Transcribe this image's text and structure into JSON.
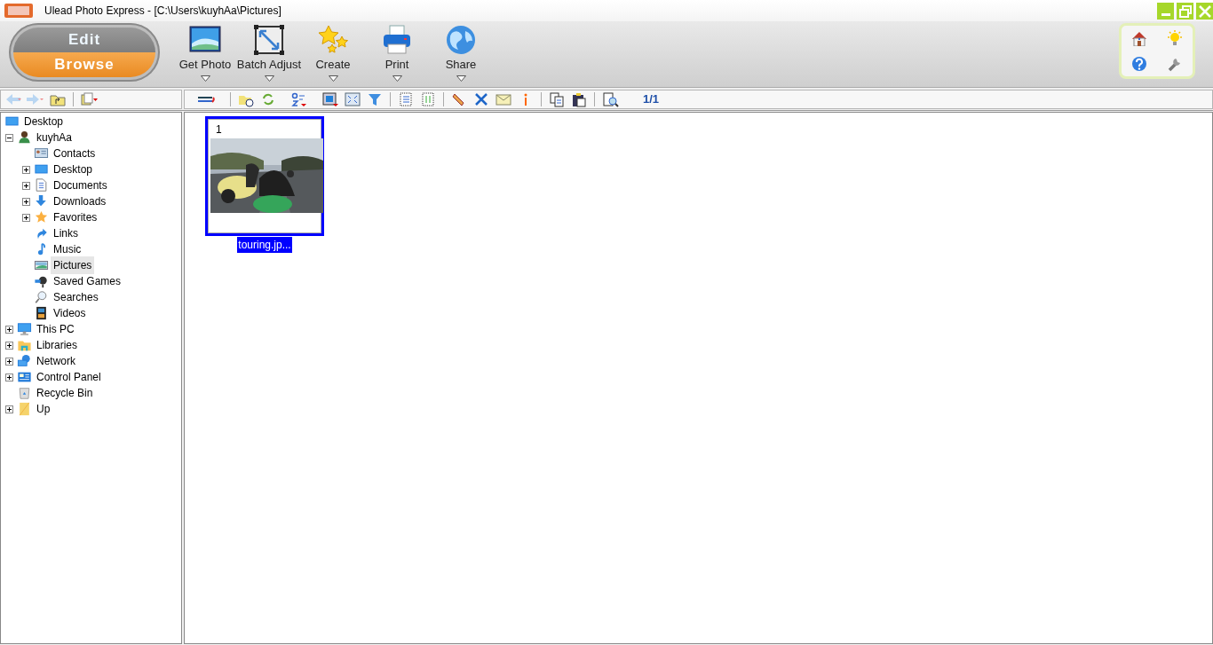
{
  "window": {
    "title": "Ulead Photo Express - [C:\\Users\\kuyhAa\\Pictures]"
  },
  "mode_switch": [
    {
      "label": "Edit",
      "selected": false
    },
    {
      "label": "Browse",
      "selected": true
    }
  ],
  "main_toolbar": [
    {
      "label": "Get Photo",
      "dropdown": true
    },
    {
      "label": "Batch Adjust",
      "dropdown": true
    },
    {
      "label": "Create",
      "dropdown": true
    },
    {
      "label": "Print",
      "dropdown": true
    },
    {
      "label": "Share",
      "dropdown": true
    }
  ],
  "browser_toolbar": {
    "page_counter": "1/1"
  },
  "folder_tree": [
    {
      "label": "Desktop",
      "selected": false,
      "children": [
        {
          "label": "kuyhAa",
          "expanded": true,
          "selected": false,
          "children": [
            {
              "label": "Contacts",
              "selected": false
            },
            {
              "label": "Desktop",
              "expanded": false,
              "selected": false
            },
            {
              "label": "Documents",
              "expanded": false,
              "selected": false
            },
            {
              "label": "Downloads",
              "expanded": false,
              "selected": false
            },
            {
              "label": "Favorites",
              "expanded": false,
              "selected": false
            },
            {
              "label": "Links",
              "selected": false
            },
            {
              "label": "Music",
              "selected": false
            },
            {
              "label": "Pictures",
              "selected": true
            },
            {
              "label": "Saved Games",
              "selected": false
            },
            {
              "label": "Searches",
              "selected": false
            },
            {
              "label": "Videos",
              "selected": false
            }
          ]
        },
        {
          "label": "This PC",
          "expanded": false,
          "selected": false
        },
        {
          "label": "Libraries",
          "expanded": false,
          "selected": false
        },
        {
          "label": "Network",
          "expanded": false,
          "selected": false
        },
        {
          "label": "Control Panel",
          "expanded": false,
          "selected": false
        },
        {
          "label": "Recycle Bin",
          "selected": false
        },
        {
          "label": "Up",
          "expanded": false,
          "selected": false
        }
      ]
    }
  ],
  "thumbnails": [
    {
      "kind": "picture",
      "number": "1",
      "filename": "touring.jp...",
      "selected": true
    }
  ]
}
